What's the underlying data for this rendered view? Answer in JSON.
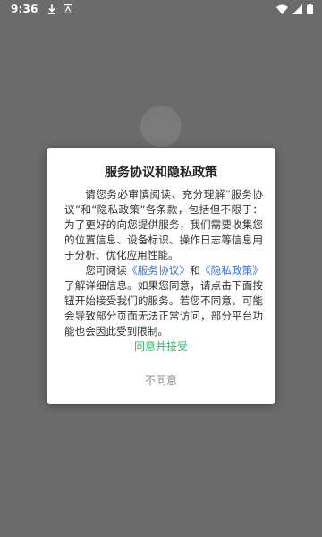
{
  "status_bar": {
    "time": "9:36"
  },
  "dialog": {
    "title": "服务协议和隐私政策",
    "paragraph1": "请您务必审慎阅读、充分理解“服务协议”和“隐私政策”各条款，包括但不限于：为了更好的向您提供服务，我们需要收集您的位置信息、设备标识、操作日志等信息用于分析、优化应用性能。",
    "paragraph2_prefix": "您可阅读",
    "service_agreement_link": "《服务协议》",
    "paragraph2_and": "和",
    "privacy_policy_link": "《隐私政策》",
    "paragraph2_suffix": "了解详细信息。如果您同意，请点击下面按钮开始接受我们的服务。若您不同意，可能会导致部分页面无法正常访问，部分平台功能也会因此受到限制。",
    "accept_label": "同意并接受",
    "reject_label": "不同意"
  },
  "colors": {
    "accent_green": "#33b86a",
    "link_blue": "#3b6fd1",
    "overlay_gray": "#6b6b6b"
  }
}
